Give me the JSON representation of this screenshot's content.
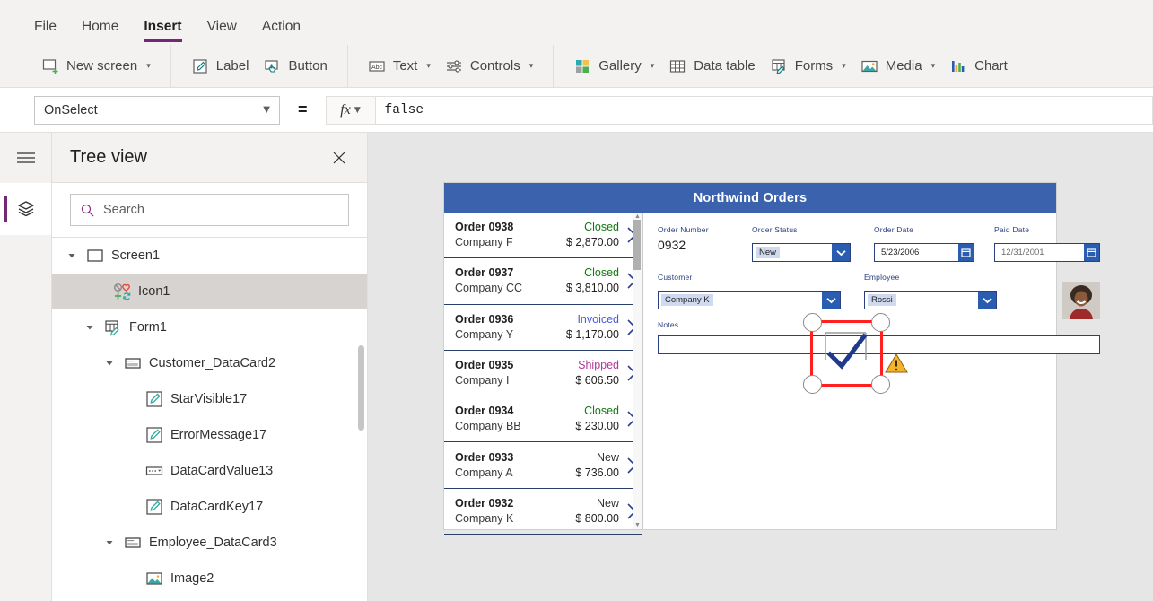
{
  "menu": {
    "tabs": [
      {
        "label": "File",
        "active": false
      },
      {
        "label": "Home",
        "active": false
      },
      {
        "label": "Insert",
        "active": true
      },
      {
        "label": "View",
        "active": false
      },
      {
        "label": "Action",
        "active": false
      }
    ]
  },
  "ribbon": {
    "groups": [
      {
        "items": [
          {
            "label": "New screen",
            "icon": "new-screen-icon",
            "caret": true
          }
        ]
      },
      {
        "items": [
          {
            "label": "Label",
            "icon": "label-icon",
            "caret": false
          },
          {
            "label": "Button",
            "icon": "button-icon",
            "caret": false
          }
        ]
      },
      {
        "items": [
          {
            "label": "Text",
            "icon": "text-icon",
            "caret": true
          },
          {
            "label": "Controls",
            "icon": "controls-icon",
            "caret": true
          }
        ]
      },
      {
        "items": [
          {
            "label": "Gallery",
            "icon": "gallery-icon",
            "caret": true
          },
          {
            "label": "Data table",
            "icon": "data-table-icon",
            "caret": false
          },
          {
            "label": "Forms",
            "icon": "forms-icon",
            "caret": true
          },
          {
            "label": "Media",
            "icon": "media-icon",
            "caret": true
          },
          {
            "label": "Chart",
            "icon": "chart-icon",
            "caret": false
          }
        ]
      }
    ]
  },
  "formula": {
    "property": "OnSelect",
    "equals": "=",
    "fx_label": "fx",
    "value": "false"
  },
  "rail": {
    "menu_icon": "hamburger-icon",
    "active_icon": "layers-icon"
  },
  "treeview": {
    "title": "Tree view",
    "close_icon": "close-icon",
    "search": {
      "value": "",
      "placeholder": "Search",
      "icon": "search-icon"
    },
    "nodes": [
      {
        "label": "Screen1",
        "indent": 0,
        "icon": "screen-icon",
        "twisty": "open",
        "selected": false
      },
      {
        "label": "Icon1",
        "indent": 1,
        "icon": "icon-control-icon",
        "twisty": "none",
        "selected": true
      },
      {
        "label": "Form1",
        "indent": 1,
        "icon": "form-icon",
        "twisty": "open",
        "selected": false
      },
      {
        "label": "Customer_DataCard2",
        "indent": 2,
        "icon": "datacard-icon",
        "twisty": "open",
        "selected": false
      },
      {
        "label": "StarVisible17",
        "indent": 3,
        "icon": "label-control-icon",
        "twisty": "none",
        "selected": false
      },
      {
        "label": "ErrorMessage17",
        "indent": 3,
        "icon": "label-control-icon",
        "twisty": "none",
        "selected": false
      },
      {
        "label": "DataCardValue13",
        "indent": 3,
        "icon": "dropdown-icon",
        "twisty": "none",
        "selected": false
      },
      {
        "label": "DataCardKey17",
        "indent": 3,
        "icon": "label-control-icon",
        "twisty": "none",
        "selected": false
      },
      {
        "label": "Employee_DataCard3",
        "indent": 2,
        "icon": "datacard-icon",
        "twisty": "open",
        "selected": false
      },
      {
        "label": "Image2",
        "indent": 3,
        "icon": "image-icon",
        "twisty": "none",
        "selected": false
      }
    ]
  },
  "app": {
    "title": "Northwind Orders",
    "title_bg": "#3b62ad",
    "gallery": {
      "rows": [
        {
          "order": "Order 0938",
          "customer": "Company F",
          "status": "Closed",
          "status_color": "#107c10",
          "amount": "$ 2,870.00"
        },
        {
          "order": "Order 0937",
          "customer": "Company CC",
          "status": "Closed",
          "status_color": "#107c10",
          "amount": "$ 3,810.00"
        },
        {
          "order": "Order 0936",
          "customer": "Company Y",
          "status": "Invoiced",
          "status_color": "#4a5bdb",
          "amount": "$ 1,170.00"
        },
        {
          "order": "Order 0935",
          "customer": "Company I",
          "status": "Shipped",
          "status_color": "#b4359b",
          "amount": "$ 606.50"
        },
        {
          "order": "Order 0934",
          "customer": "Company BB",
          "status": "Closed",
          "status_color": "#107c10",
          "amount": "$ 230.00"
        },
        {
          "order": "Order 0933",
          "customer": "Company A",
          "status": "New",
          "status_color": "#323130",
          "amount": "$ 736.00"
        },
        {
          "order": "Order 0932",
          "customer": "Company K",
          "status": "New",
          "status_color": "#323130",
          "amount": "$ 800.00"
        }
      ],
      "chevron_icon": "chevron-right-icon",
      "warning_icon": "warning-icon"
    },
    "form": {
      "order_number": {
        "label": "Order Number",
        "value": "0932"
      },
      "order_status": {
        "label": "Order Status",
        "value": "New",
        "icon": "chevron-down-icon"
      },
      "order_date": {
        "label": "Order Date",
        "value": "5/23/2006",
        "icon": "calendar-icon"
      },
      "paid_date": {
        "label": "Paid Date",
        "value": "12/31/2001",
        "icon": "calendar-icon"
      },
      "customer": {
        "label": "Customer",
        "value": "Company K",
        "icon": "chevron-down-icon"
      },
      "employee": {
        "label": "Employee",
        "value": "Rossi",
        "icon": "chevron-down-icon"
      },
      "notes": {
        "label": "Notes",
        "value": ""
      },
      "avatar": {
        "name": "employee-avatar"
      }
    }
  },
  "selection": {
    "color": "#ff2020",
    "glyph_icon": "check-mark-icon"
  }
}
